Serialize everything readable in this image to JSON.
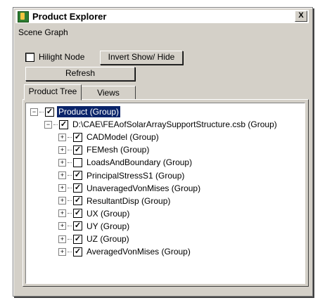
{
  "window": {
    "title": "Product Explorer",
    "close": "X"
  },
  "scene_label": "Scene Graph",
  "hilight": {
    "label": "Hilight Node",
    "checked": false
  },
  "buttons": {
    "invert": "Invert Show/ Hide",
    "refresh": "Refresh"
  },
  "tabs": [
    {
      "label": "Product Tree",
      "active": true
    },
    {
      "label": "Views",
      "active": false
    }
  ],
  "tree": [
    {
      "label": "Product (Group)",
      "checked": true,
      "expander": "−",
      "selected": true
    },
    {
      "label": "D:\\CAE\\FEAofSolarArraySupportStructure.csb (Group)",
      "checked": true,
      "expander": "−"
    },
    {
      "label": "CADModel (Group)",
      "checked": true,
      "expander": "+"
    },
    {
      "label": "FEMesh (Group)",
      "checked": true,
      "expander": "+"
    },
    {
      "label": "LoadsAndBoundary (Group)",
      "checked": false,
      "expander": "+"
    },
    {
      "label": "PrincipalStressS1 (Group)",
      "checked": true,
      "expander": "+"
    },
    {
      "label": "UnaveragedVonMises (Group)",
      "checked": true,
      "expander": "+"
    },
    {
      "label": "ResultantDisp (Group)",
      "checked": true,
      "expander": "+"
    },
    {
      "label": "UX (Group)",
      "checked": true,
      "expander": "+"
    },
    {
      "label": "UY (Group)",
      "checked": true,
      "expander": "+"
    },
    {
      "label": "UZ (Group)",
      "checked": true,
      "expander": "+"
    },
    {
      "label": "AveragedVonMises (Group)",
      "checked": true,
      "expander": "+"
    }
  ],
  "check_glyph": "✓"
}
